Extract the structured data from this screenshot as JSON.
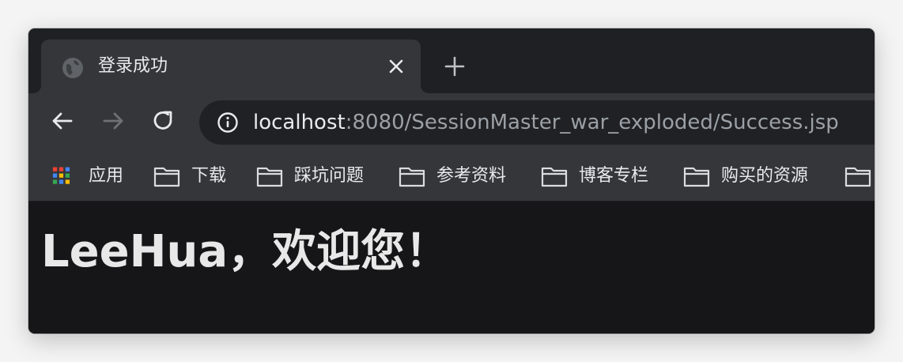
{
  "tab": {
    "title": "登录成功",
    "favicon": "globe-icon"
  },
  "toolbar": {
    "url_host": "localhost",
    "url_rest": ":8080/SessionMaster_war_exploded/Success.jsp"
  },
  "bookmarks": {
    "apps_label": "应用",
    "items": [
      "下载",
      "踩坑问题",
      "参考资料",
      "博客专栏",
      "购买的资源"
    ]
  },
  "page": {
    "greeting": "LeeHua，欢迎您！"
  },
  "colors": {
    "tabstrip": "#1f2023",
    "tab_active": "#35363a",
    "omnibox": "#202124",
    "page_background": "#161618",
    "text_primary": "#e8eaed",
    "text_secondary": "#9aa0a6"
  }
}
